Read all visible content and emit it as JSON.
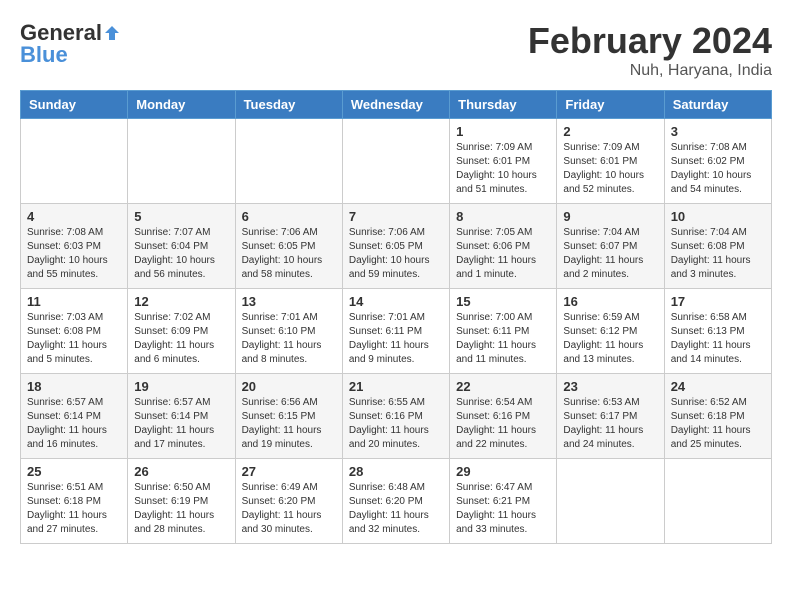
{
  "header": {
    "logo_general": "General",
    "logo_blue": "Blue",
    "month_title": "February 2024",
    "location": "Nuh, Haryana, India"
  },
  "days_of_week": [
    "Sunday",
    "Monday",
    "Tuesday",
    "Wednesday",
    "Thursday",
    "Friday",
    "Saturday"
  ],
  "weeks": [
    [
      {
        "day": "",
        "info": ""
      },
      {
        "day": "",
        "info": ""
      },
      {
        "day": "",
        "info": ""
      },
      {
        "day": "",
        "info": ""
      },
      {
        "day": "1",
        "info": "Sunrise: 7:09 AM\nSunset: 6:01 PM\nDaylight: 10 hours\nand 51 minutes."
      },
      {
        "day": "2",
        "info": "Sunrise: 7:09 AM\nSunset: 6:01 PM\nDaylight: 10 hours\nand 52 minutes."
      },
      {
        "day": "3",
        "info": "Sunrise: 7:08 AM\nSunset: 6:02 PM\nDaylight: 10 hours\nand 54 minutes."
      }
    ],
    [
      {
        "day": "4",
        "info": "Sunrise: 7:08 AM\nSunset: 6:03 PM\nDaylight: 10 hours\nand 55 minutes."
      },
      {
        "day": "5",
        "info": "Sunrise: 7:07 AM\nSunset: 6:04 PM\nDaylight: 10 hours\nand 56 minutes."
      },
      {
        "day": "6",
        "info": "Sunrise: 7:06 AM\nSunset: 6:05 PM\nDaylight: 10 hours\nand 58 minutes."
      },
      {
        "day": "7",
        "info": "Sunrise: 7:06 AM\nSunset: 6:05 PM\nDaylight: 10 hours\nand 59 minutes."
      },
      {
        "day": "8",
        "info": "Sunrise: 7:05 AM\nSunset: 6:06 PM\nDaylight: 11 hours\nand 1 minute."
      },
      {
        "day": "9",
        "info": "Sunrise: 7:04 AM\nSunset: 6:07 PM\nDaylight: 11 hours\nand 2 minutes."
      },
      {
        "day": "10",
        "info": "Sunrise: 7:04 AM\nSunset: 6:08 PM\nDaylight: 11 hours\nand 3 minutes."
      }
    ],
    [
      {
        "day": "11",
        "info": "Sunrise: 7:03 AM\nSunset: 6:08 PM\nDaylight: 11 hours\nand 5 minutes."
      },
      {
        "day": "12",
        "info": "Sunrise: 7:02 AM\nSunset: 6:09 PM\nDaylight: 11 hours\nand 6 minutes."
      },
      {
        "day": "13",
        "info": "Sunrise: 7:01 AM\nSunset: 6:10 PM\nDaylight: 11 hours\nand 8 minutes."
      },
      {
        "day": "14",
        "info": "Sunrise: 7:01 AM\nSunset: 6:11 PM\nDaylight: 11 hours\nand 9 minutes."
      },
      {
        "day": "15",
        "info": "Sunrise: 7:00 AM\nSunset: 6:11 PM\nDaylight: 11 hours\nand 11 minutes."
      },
      {
        "day": "16",
        "info": "Sunrise: 6:59 AM\nSunset: 6:12 PM\nDaylight: 11 hours\nand 13 minutes."
      },
      {
        "day": "17",
        "info": "Sunrise: 6:58 AM\nSunset: 6:13 PM\nDaylight: 11 hours\nand 14 minutes."
      }
    ],
    [
      {
        "day": "18",
        "info": "Sunrise: 6:57 AM\nSunset: 6:14 PM\nDaylight: 11 hours\nand 16 minutes."
      },
      {
        "day": "19",
        "info": "Sunrise: 6:57 AM\nSunset: 6:14 PM\nDaylight: 11 hours\nand 17 minutes."
      },
      {
        "day": "20",
        "info": "Sunrise: 6:56 AM\nSunset: 6:15 PM\nDaylight: 11 hours\nand 19 minutes."
      },
      {
        "day": "21",
        "info": "Sunrise: 6:55 AM\nSunset: 6:16 PM\nDaylight: 11 hours\nand 20 minutes."
      },
      {
        "day": "22",
        "info": "Sunrise: 6:54 AM\nSunset: 6:16 PM\nDaylight: 11 hours\nand 22 minutes."
      },
      {
        "day": "23",
        "info": "Sunrise: 6:53 AM\nSunset: 6:17 PM\nDaylight: 11 hours\nand 24 minutes."
      },
      {
        "day": "24",
        "info": "Sunrise: 6:52 AM\nSunset: 6:18 PM\nDaylight: 11 hours\nand 25 minutes."
      }
    ],
    [
      {
        "day": "25",
        "info": "Sunrise: 6:51 AM\nSunset: 6:18 PM\nDaylight: 11 hours\nand 27 minutes."
      },
      {
        "day": "26",
        "info": "Sunrise: 6:50 AM\nSunset: 6:19 PM\nDaylight: 11 hours\nand 28 minutes."
      },
      {
        "day": "27",
        "info": "Sunrise: 6:49 AM\nSunset: 6:20 PM\nDaylight: 11 hours\nand 30 minutes."
      },
      {
        "day": "28",
        "info": "Sunrise: 6:48 AM\nSunset: 6:20 PM\nDaylight: 11 hours\nand 32 minutes."
      },
      {
        "day": "29",
        "info": "Sunrise: 6:47 AM\nSunset: 6:21 PM\nDaylight: 11 hours\nand 33 minutes."
      },
      {
        "day": "",
        "info": ""
      },
      {
        "day": "",
        "info": ""
      }
    ]
  ]
}
